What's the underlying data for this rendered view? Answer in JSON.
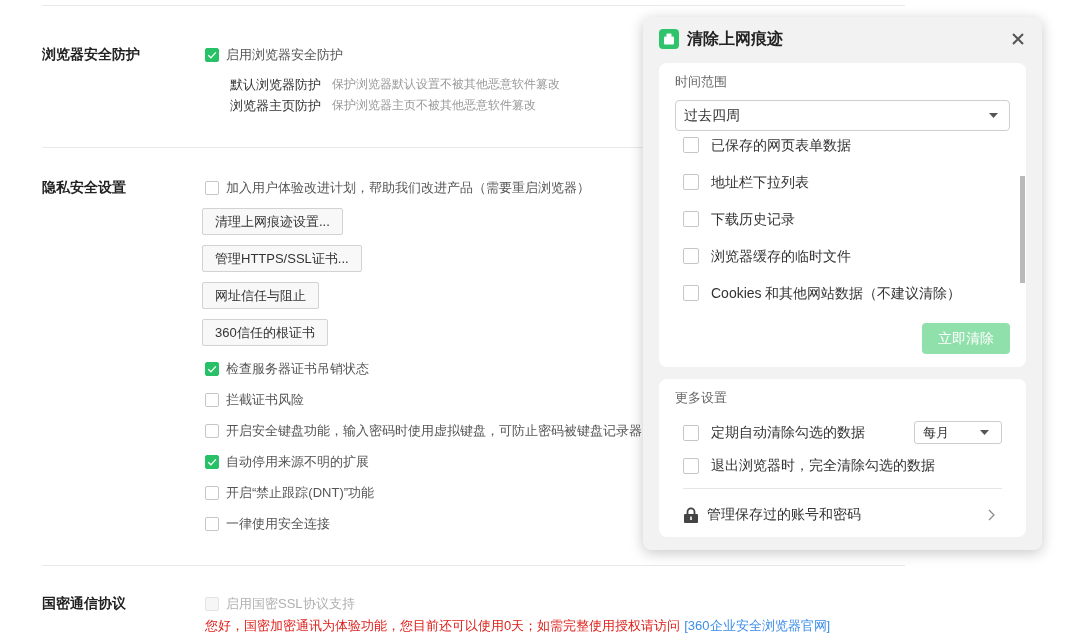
{
  "sections": [
    {
      "title": "浏览器安全防护",
      "items": [
        {
          "kind": "checkbox",
          "label": "启用浏览器安全防护",
          "checked": true,
          "disabled": false
        },
        {
          "kind": "info",
          "label": "默认浏览器防护",
          "description": "保护浏览器默认设置不被其他恶意软件篡改"
        },
        {
          "kind": "info",
          "label": "浏览器主页防护",
          "description": "保护浏览器主页不被其他恶意软件篡改"
        }
      ]
    },
    {
      "title": "隐私安全设置",
      "items": [
        {
          "kind": "checkbox",
          "label": "加入用户体验改进计划，帮助我们改进产品（需要重启浏览器）",
          "checked": false,
          "disabled": false
        },
        {
          "kind": "button",
          "label": "清理上网痕迹设置..."
        },
        {
          "kind": "button",
          "label": "管理HTTPS/SSL证书..."
        },
        {
          "kind": "button",
          "label": "网址信任与阻止"
        },
        {
          "kind": "button",
          "label": "360信任的根证书"
        },
        {
          "kind": "checkbox",
          "label": "检查服务器证书吊销状态",
          "checked": true,
          "disabled": false
        },
        {
          "kind": "checkbox",
          "label": "拦截证书风险",
          "checked": false,
          "disabled": false
        },
        {
          "kind": "checkbox",
          "label": "开启安全键盘功能，输入密码时使用虚拟键盘，可防止密码被键盘记录器",
          "checked": false,
          "disabled": false
        },
        {
          "kind": "checkbox",
          "label": "自动停用来源不明的扩展",
          "checked": true,
          "disabled": false
        },
        {
          "kind": "checkbox",
          "label": "开启“禁止跟踪(DNT)”功能",
          "checked": false,
          "disabled": false
        },
        {
          "kind": "checkbox",
          "label": "一律使用安全连接",
          "checked": false,
          "disabled": false
        }
      ]
    },
    {
      "title": "国密通信协议",
      "items": [
        {
          "kind": "checkbox",
          "label": "启用国密SSL协议支持",
          "checked": false,
          "disabled": true
        },
        {
          "kind": "notice",
          "text": "您好，国密加密通讯为体验功能，您目前还可以使用0天；如需完整使用授权请访问",
          "link": "[360企业安全浏览器官网]"
        }
      ]
    }
  ],
  "dialog": {
    "title": "清除上网痕迹",
    "time_range": {
      "label": "时间范围",
      "value": "过去四周"
    },
    "items": [
      {
        "label": "已保存的网页表单数据",
        "checked": false
      },
      {
        "label": "地址栏下拉列表",
        "checked": false
      },
      {
        "label": "下载历史记录",
        "checked": false
      },
      {
        "label": "浏览器缓存的临时文件",
        "checked": false
      },
      {
        "label": "Cookies 和其他网站数据（不建议清除）",
        "checked": false
      }
    ],
    "clear_button": {
      "label": "立即清除",
      "disabled": true
    },
    "more_settings": {
      "title": "更多设置",
      "options": [
        {
          "kind": "schedule",
          "label": "定期自动清除勾选的数据",
          "checked": false,
          "frequency": "每月"
        },
        {
          "kind": "plain",
          "label": "退出浏览器时，完全清除勾选的数据",
          "checked": false
        }
      ],
      "link": "管理保存过的账号和密码"
    }
  }
}
